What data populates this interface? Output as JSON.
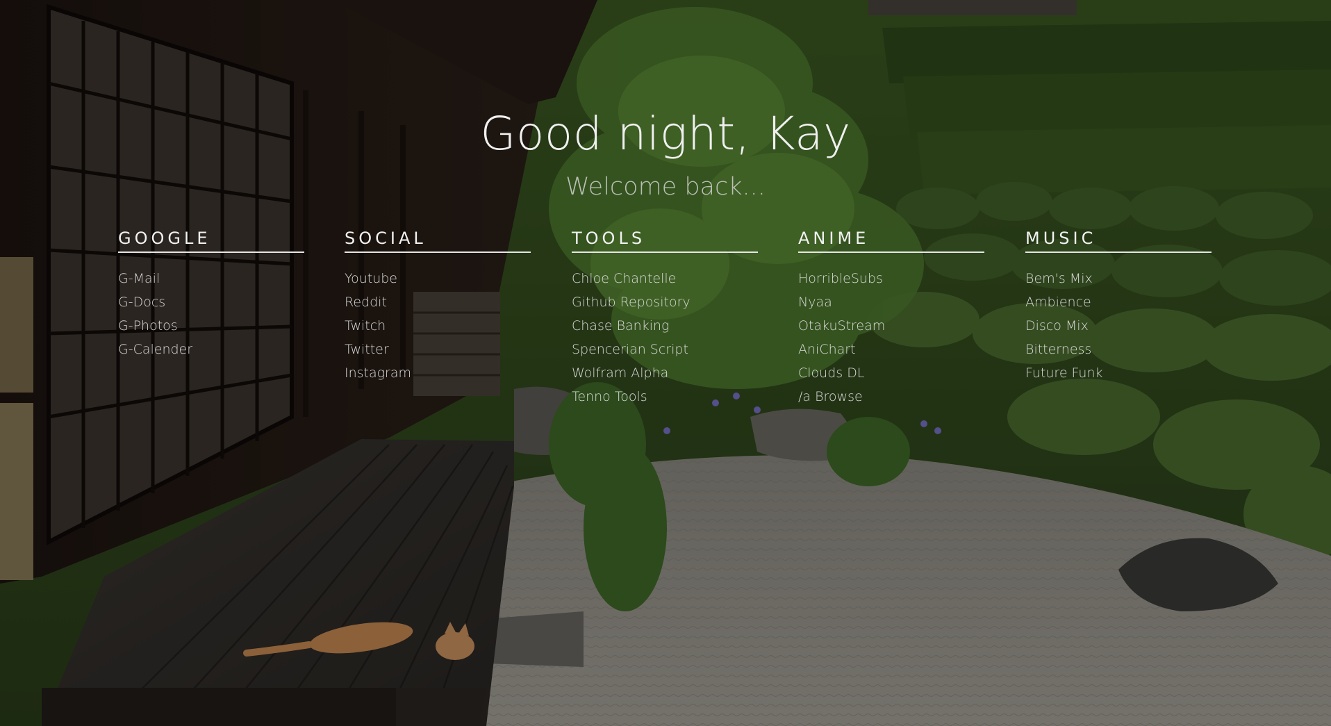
{
  "greeting": "Good night, Kay",
  "subtitle": "Welcome back...",
  "columns": [
    {
      "heading": "GOOGLE",
      "links": [
        "G-Mail",
        "G-Docs",
        "G-Photos",
        "G-Calender"
      ]
    },
    {
      "heading": "SOCIAL",
      "links": [
        "Youtube",
        "Reddit",
        "Twitch",
        "Twitter",
        "Instagram"
      ]
    },
    {
      "heading": "TOOLS",
      "links": [
        "Chloe Chantelle",
        "Github Repository",
        "Chase Banking",
        "Spencerian Script",
        "Wolfram Alpha",
        "Tenno Tools"
      ]
    },
    {
      "heading": "ANIME",
      "links": [
        "HorribleSubs",
        "Nyaa",
        "OtakuStream",
        "AniChart",
        "Clouds DL",
        "/a Browse"
      ]
    },
    {
      "heading": "MUSIC",
      "links": [
        "Bem's Mix",
        "Ambience",
        "Disco Mix",
        "Bitterness",
        "Future Funk"
      ]
    }
  ],
  "colors": {
    "overlay": "#000000",
    "text": "#e6e6e6"
  },
  "background_image": "japanese-garden-photo"
}
